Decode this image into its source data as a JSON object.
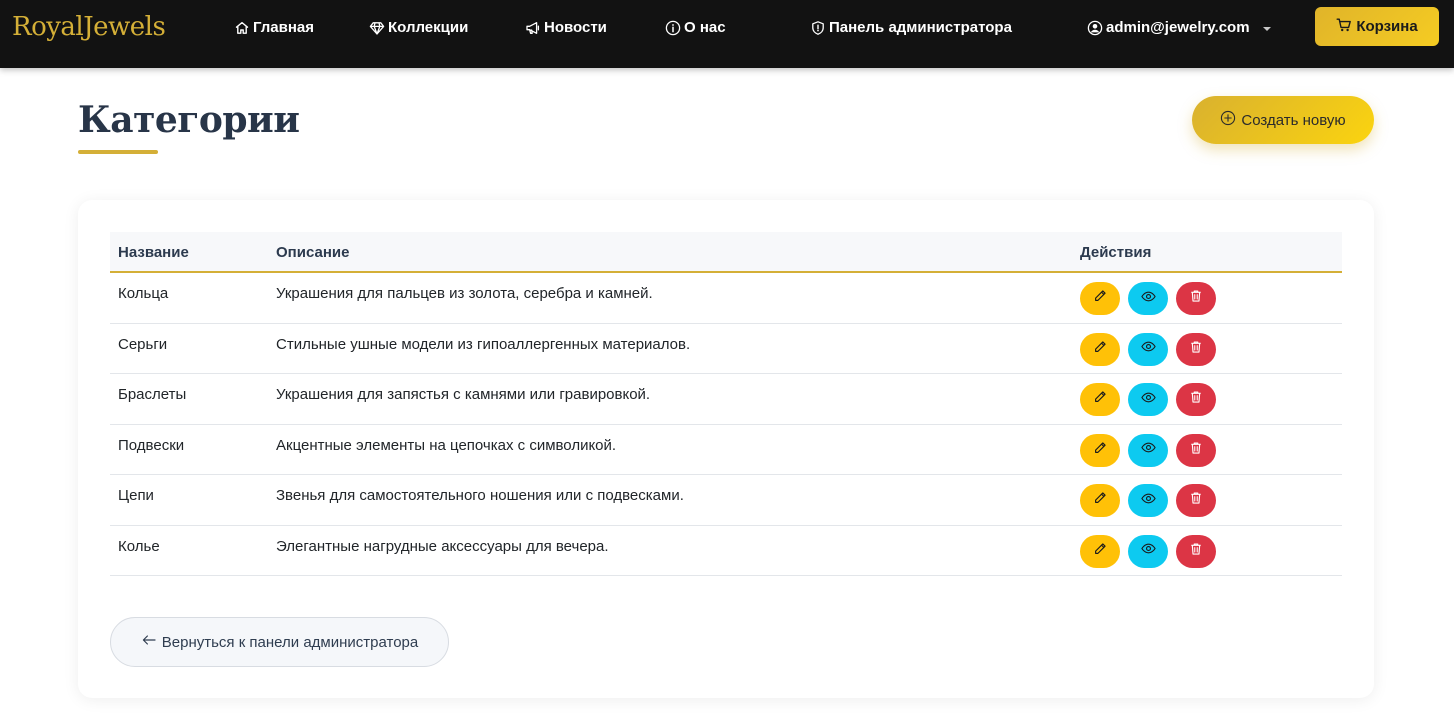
{
  "navbar": {
    "brand": "RoyalJewels",
    "links": {
      "home": "Главная",
      "collections": "Коллекции",
      "news": "Новости",
      "about": "О нас",
      "admin": "Панель администратора"
    },
    "user_email": "admin@jewelry.com",
    "cart_label": "Корзина"
  },
  "header": {
    "title": "Категории",
    "create_label": "Создать новую"
  },
  "table": {
    "columns": {
      "name": "Название",
      "description": "Описание",
      "actions": "Действия"
    },
    "rows": [
      {
        "name": "Кольца",
        "description": "Украшения для пальцев из золота, серебра и камней."
      },
      {
        "name": "Серьги",
        "description": "Стильные ушные модели из гипоаллергенных материалов."
      },
      {
        "name": "Браслеты",
        "description": "Украшения для запястья с камнями или гравировкой."
      },
      {
        "name": "Подвески",
        "description": "Акцентные элементы на цепочках с символикой."
      },
      {
        "name": "Цепи",
        "description": "Звенья для самостоятельного ношения или с подвесками."
      },
      {
        "name": "Колье",
        "description": "Элегантные нагрудные аксессуары для вечера."
      }
    ],
    "action_icons": [
      "pencil-icon",
      "eye-icon",
      "trash-icon"
    ]
  },
  "footer": {
    "back_label": "Вернуться к панели администратора"
  },
  "colors": {
    "navbar_bg": "#121212",
    "brand_gold": "#d4af37",
    "accent_yellow": "#ffc107",
    "info_cyan": "#0dcaf0",
    "danger_red": "#dc3545",
    "title_navy": "#283548"
  }
}
